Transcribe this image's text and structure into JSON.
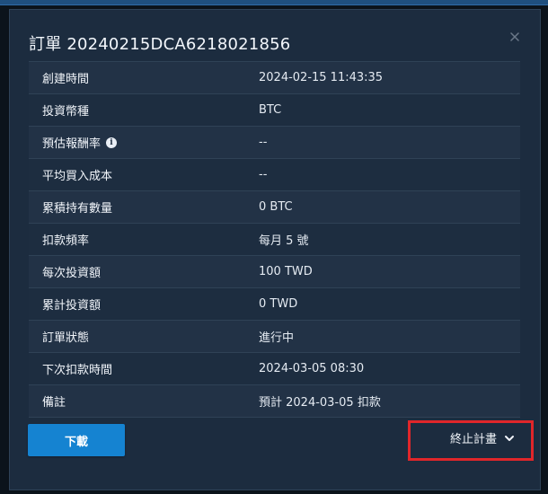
{
  "modal": {
    "title": "訂單 20240215DCA6218021856",
    "close_icon": "close-icon"
  },
  "details": [
    {
      "label": "創建時間",
      "value": "2024-02-15 11:43:35"
    },
    {
      "label": "投資幣種",
      "value": "BTC"
    },
    {
      "label": "預估報酬率",
      "value": "--",
      "info_icon": "info-icon"
    },
    {
      "label": "平均買入成本",
      "value": "--"
    },
    {
      "label": "累積持有數量",
      "value": "0 BTC"
    },
    {
      "label": "扣款頻率",
      "value": "每月 5 號"
    },
    {
      "label": "每次投資額",
      "value": "100 TWD"
    },
    {
      "label": "累計投資額",
      "value": "0 TWD"
    },
    {
      "label": "訂單狀態",
      "value": "進行中"
    },
    {
      "label": "下次扣款時間",
      "value": "2024-03-05 08:30"
    },
    {
      "label": "備註",
      "value": "預計 2024-03-05 扣款"
    }
  ],
  "actions": {
    "download_label": "下載",
    "terminate_label": "終止計畫",
    "terminate_icon": "chevron-down-icon"
  },
  "colors": {
    "modal_bg": "#1c2c3f",
    "row_odd": "#223246",
    "row_even": "#1d2d40",
    "primary_button": "#1583d1",
    "highlight_border": "#e0262a"
  }
}
